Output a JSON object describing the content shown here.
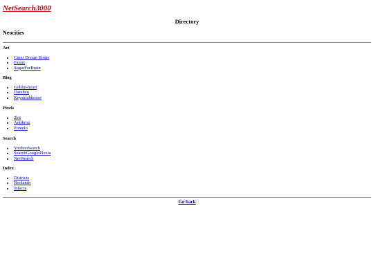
{
  "logo": {
    "text": "NetSearch3000",
    "color": "#d00000"
  },
  "page_title": "Directory",
  "section_title": "Neocities",
  "categories": [
    {
      "name": "Art",
      "links": [
        "Cinni Dream Home",
        "Fauux",
        "SugarForBrain"
      ]
    },
    {
      "name": "Blog",
      "links": [
        "Goblin-heart",
        "Dandien",
        "Keysklubhouse"
      ]
    },
    {
      "name": "Pixels",
      "links": [
        "2bit",
        "Antikrist",
        "Pomelo"
      ]
    },
    {
      "name": "Search",
      "links": [
        "YoohooSearch",
        "SearchGoogloPlexia",
        "NeoSearch"
      ]
    },
    {
      "name": "Index",
      "links": [
        "Districts",
        "Neolands",
        "Infacra"
      ]
    }
  ],
  "footer": {
    "back_label": "Go back"
  },
  "colors": {
    "link": "#0000cc",
    "rule": "#9a9a9a"
  }
}
